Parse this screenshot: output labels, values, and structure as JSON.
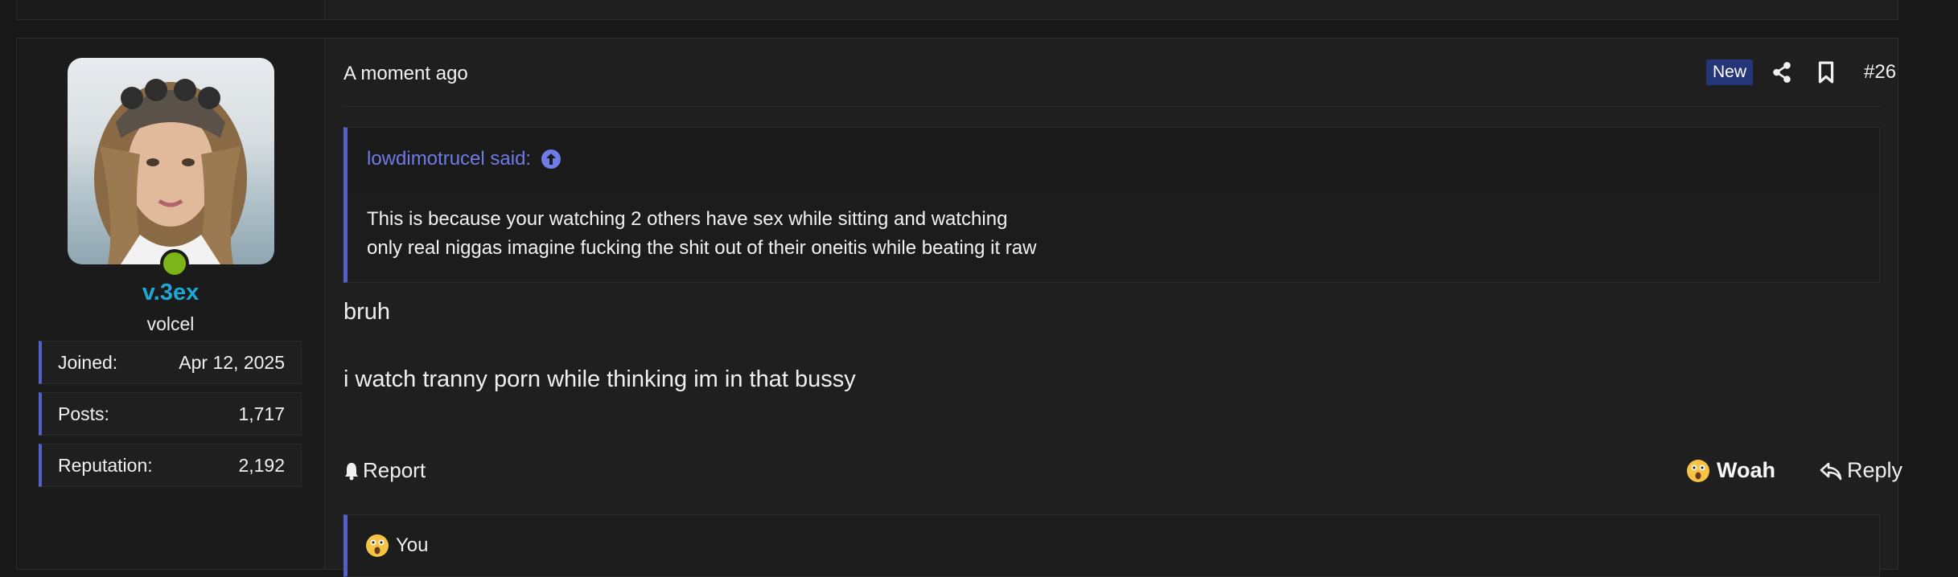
{
  "post": {
    "timestamp": "A moment ago",
    "new_badge": "New",
    "post_number": "#26",
    "user": {
      "name": "v.3ex",
      "title": "volcel",
      "stats": [
        {
          "label": "Joined:",
          "value": "Apr 12, 2025"
        },
        {
          "label": "Posts:",
          "value": "1,717"
        },
        {
          "label": "Reputation:",
          "value": "2,192"
        }
      ]
    },
    "quote": {
      "author_text": "lowdimotrucel said:",
      "lines": [
        "This is because your watching 2 others have sex while sitting and watching",
        "only real niggas imagine fucking the shit out of their oneitis while beating it raw"
      ]
    },
    "message": {
      "paragraphs": [
        "bruh",
        "i watch tranny porn while thinking im in that bussy"
      ]
    },
    "actions": {
      "report_label": "Report",
      "woah_label": "Woah",
      "reply_label": "Reply"
    },
    "reactions": {
      "text": "You",
      "emoji": "astonished-face-icon"
    }
  },
  "colors": {
    "accent": "#5560c5",
    "username": "#1fa7d6",
    "new_badge_bg": "#25357a",
    "online": "#7cb518"
  }
}
